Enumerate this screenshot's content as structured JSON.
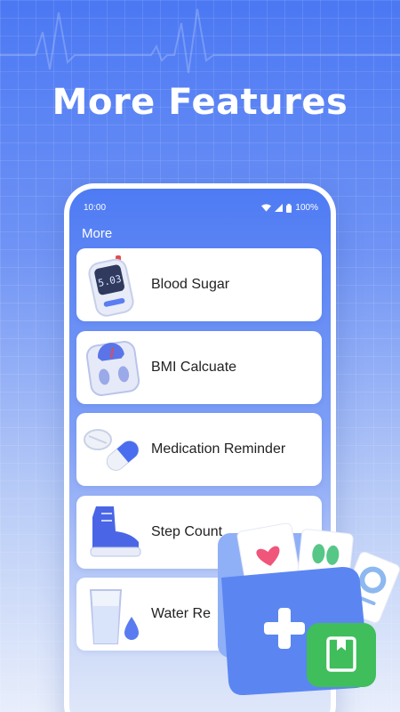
{
  "headline": "More Features",
  "status_bar": {
    "time": "10:00",
    "battery": "100%"
  },
  "screen_title": "More",
  "features": [
    {
      "label": "Blood Sugar",
      "icon": "glucose-meter-icon",
      "meter_reading": "5.03"
    },
    {
      "label": "BMI Calcuate",
      "icon": "scale-icon"
    },
    {
      "label": "Medication Reminder",
      "icon": "pills-icon"
    },
    {
      "label": "Step Count",
      "icon": "shoe-icon"
    },
    {
      "label": "Water Re",
      "icon": "water-glass-icon"
    }
  ],
  "colors": {
    "background": "#4b78f3",
    "folder_front": "#5b86f2",
    "folder_back": "#8fb0f7",
    "book_badge": "#3fbe5b",
    "pill_blue": "#4a6df0"
  }
}
